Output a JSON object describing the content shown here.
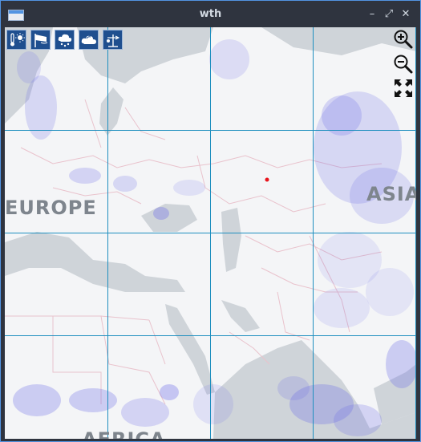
{
  "window": {
    "title": "wth",
    "minimize_label": "–",
    "maximize_label": "⤢",
    "close_label": "✕"
  },
  "toolbar": {
    "layers": [
      {
        "icon": "temperature-layer-icon"
      },
      {
        "icon": "wind-layer-icon"
      },
      {
        "icon": "precipitation-layer-icon"
      },
      {
        "icon": "clouds-layer-icon"
      },
      {
        "icon": "pressure-layer-icon"
      }
    ]
  },
  "map_controls": {
    "zoom_in": "zoom-in-icon",
    "zoom_out": "zoom-out-icon",
    "fullscreen": "fullscreen-icon"
  },
  "map": {
    "labels": {
      "europe": "EUROPE",
      "asia": "ASIA",
      "africa": "AFRICA"
    },
    "colors": {
      "land": "#f4f5f7",
      "water": "#cfd4d9",
      "grid": "#1f8fbf",
      "borders": "#e9c2cc",
      "precipitation": "#6e6ee8",
      "marker": "#e8141c"
    }
  }
}
